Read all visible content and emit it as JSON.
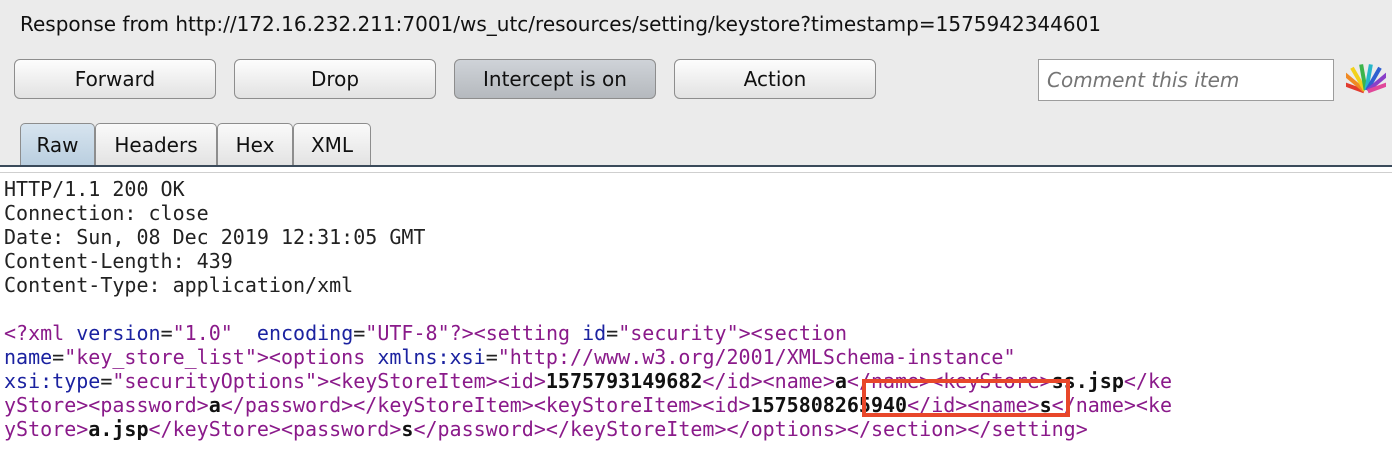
{
  "title": "Response from http://172.16.232.211:7001/ws_utc/resources/setting/keystore?timestamp=1575942344601",
  "toolbar": {
    "forward": "Forward",
    "drop": "Drop",
    "intercept": "Intercept is on",
    "action": "Action",
    "comment_placeholder": "Comment this item"
  },
  "tabs": [
    "Raw",
    "Headers",
    "Hex",
    "XML"
  ],
  "response": {
    "status": "HTTP/1.1 200 OK",
    "connection": "Connection: close",
    "date": "Date: Sun, 08 Dec 2019 12:31:05 GMT",
    "length": "Content-Length: 439",
    "ctype": "Content-Type: application/xml",
    "xml_decl_version": "1.0",
    "xml_decl_encoding": "UTF-8",
    "setting_id": "security",
    "section_name": "key_store_list",
    "xmlns_xsi": "http://www.w3.org/2001/XMLSchema-instance",
    "xsi_type": "securityOptions",
    "id1": "1575793149682",
    "name1": "a",
    "keystore1": "ss.jsp",
    "password1": "a",
    "id2": "1575808265940",
    "name2": "s",
    "keystore2": "a.jsp",
    "password2": "s"
  },
  "highlight_color": "#e8472a"
}
